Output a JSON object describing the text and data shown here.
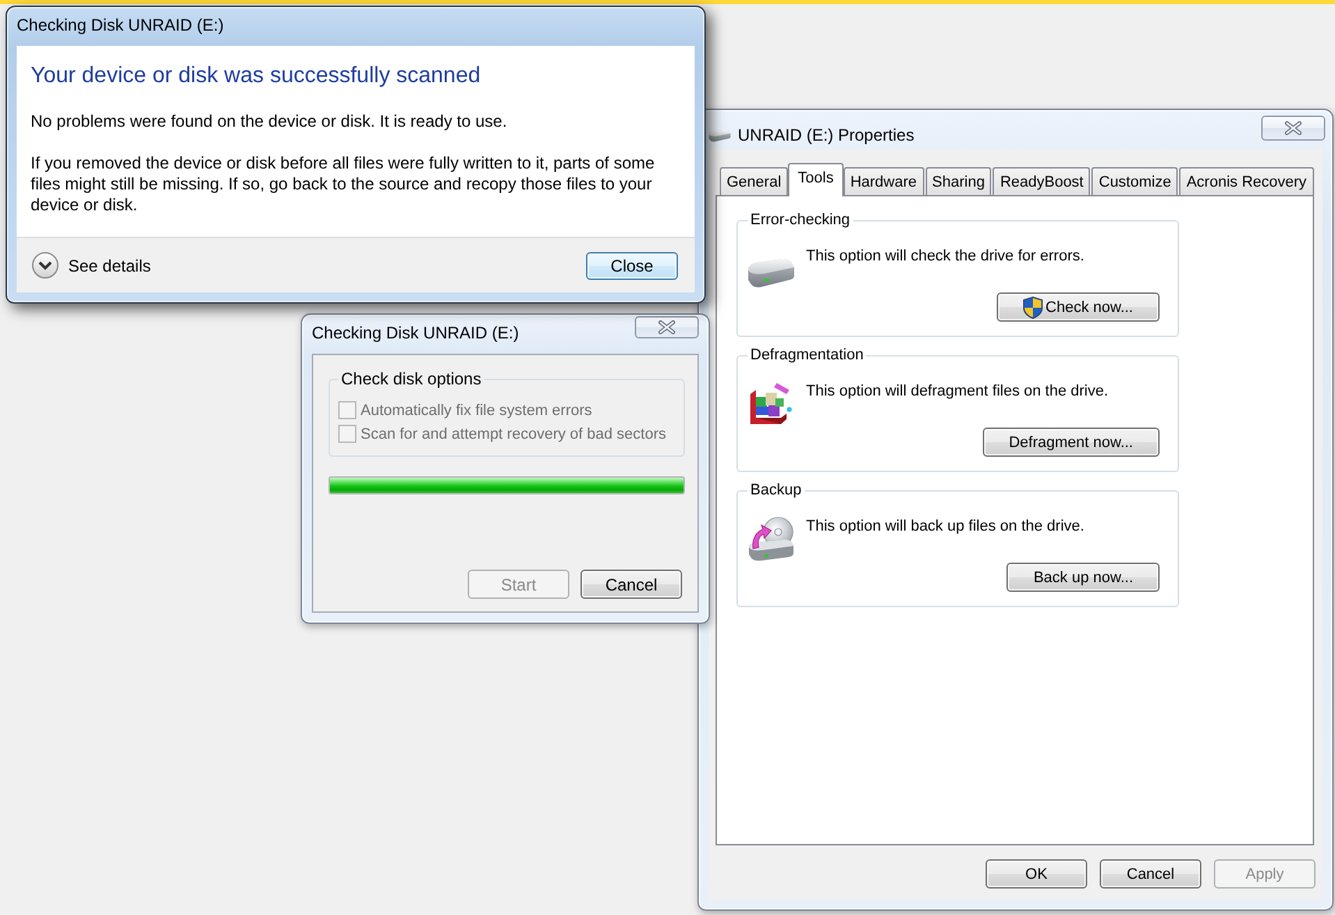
{
  "result_dialog": {
    "title": "Checking Disk UNRAID (E:)",
    "active": true,
    "heading": "Your device or disk was successfully scanned",
    "paragraphs": [
      "No problems were found on the device or disk. It is ready to use.",
      "If you removed the device or disk before all files were fully written to it, parts of some files might still be missing. If so, go back to the source and recopy those files to your device or disk."
    ],
    "details_toggle": {
      "label": "See details",
      "expanded": false
    },
    "buttons": [
      {
        "label": "Close",
        "default": true
      }
    ]
  },
  "properties_dialog": {
    "title": "UNRAID (E:) Properties",
    "active": false,
    "tabs": [
      {
        "label": "General",
        "selected": false
      },
      {
        "label": "Tools",
        "selected": true
      },
      {
        "label": "Hardware",
        "selected": false
      },
      {
        "label": "Sharing",
        "selected": false
      },
      {
        "label": "ReadyBoost",
        "selected": false
      },
      {
        "label": "Customize",
        "selected": false
      },
      {
        "label": "Acronis Recovery",
        "selected": false
      }
    ],
    "groups": [
      {
        "kind": "check",
        "title": "Error-checking",
        "description": "This option will check the drive for errors.",
        "button": "Check now..."
      },
      {
        "kind": "defrag",
        "title": "Defragmentation",
        "description": "This option will defragment files on the drive.",
        "button": "Defragment now..."
      },
      {
        "kind": "backup",
        "title": "Backup",
        "description": "This option will back up files on the drive.",
        "button": "Back up now..."
      }
    ],
    "buttons": [
      {
        "label": "OK",
        "disabled": false
      },
      {
        "label": "Cancel",
        "disabled": false
      },
      {
        "label": "Apply",
        "disabled": true
      }
    ]
  },
  "check_disk_dialog": {
    "title": "Checking Disk UNRAID (E:)",
    "active": false,
    "group_title": "Check disk options",
    "options": [
      {
        "label": "Automatically fix file system errors",
        "checked": false,
        "disabled": true
      },
      {
        "label": "Scan for and attempt recovery of bad sectors",
        "checked": false,
        "disabled": true
      }
    ],
    "progress": {
      "level": 1
    },
    "buttons": [
      {
        "label": "Start",
        "disabled": true
      },
      {
        "label": "Cancel",
        "disabled": false
      }
    ]
  }
}
